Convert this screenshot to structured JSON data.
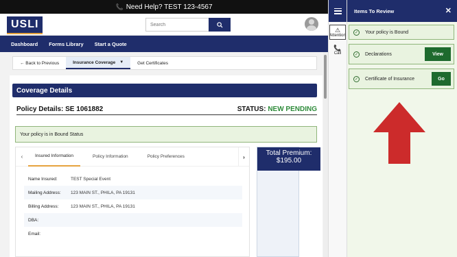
{
  "topbar": {
    "phone_icon": "phone-icon",
    "help_text": "Need Help? TEST 123-4567"
  },
  "header": {
    "logo": "USLI",
    "search_placeholder": "Search",
    "search_icon": "search-icon",
    "avatar_icon": "user-avatar-icon"
  },
  "nav": {
    "items": [
      "Dashboard",
      "Forms Library",
      "Start a Quote"
    ]
  },
  "subnav": {
    "back": "← Back to Previous",
    "coverage": "Insurance Coverage",
    "certificates": "Get Certificates"
  },
  "coverage": {
    "title": "Coverage Details"
  },
  "policy": {
    "title": "Policy Details: SE 1061882",
    "status_label": "STATUS:",
    "status_value": "NEW PENDING",
    "status_color": "#2e8b3a"
  },
  "alert": {
    "text": "Your policy is in Bound Status"
  },
  "tabs": {
    "items": [
      "Insured Information",
      "Policy Information",
      "Policy Preferences"
    ],
    "active": 0
  },
  "insured": {
    "rows": [
      {
        "label": "Name Insured:",
        "value": "TEST Special Event"
      },
      {
        "label": "Mailing Address:",
        "value": "123 MAIN ST., PHILA, PA 19131"
      },
      {
        "label": "Billing Address:",
        "value": "123 MAIN ST., PHILA, PA 19131"
      },
      {
        "label": "DBA:",
        "value": ""
      },
      {
        "label": "Email:",
        "value": ""
      }
    ]
  },
  "premium": {
    "label": "Total Premium:",
    "value": "$195.00"
  },
  "rail": {
    "attention": "Attention",
    "call": "Call"
  },
  "review": {
    "title": "Items To Review",
    "items": [
      {
        "label": "Your policy is Bound",
        "button": ""
      },
      {
        "label": "Declarations",
        "button": "View"
      },
      {
        "label": "Certificate of Insurance",
        "button": "Go"
      }
    ]
  },
  "colors": {
    "brand_navy": "#1f2d6b",
    "accent_orange": "#e6a23c",
    "success_green": "#1e6a2e",
    "arrow_red": "#cc2b2b"
  }
}
